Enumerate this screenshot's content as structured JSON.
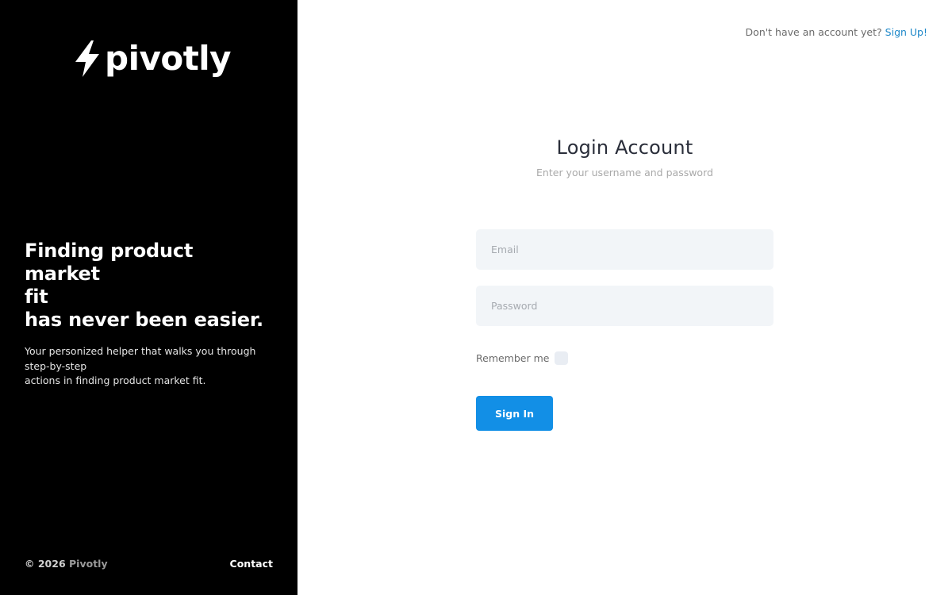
{
  "brand": {
    "name": "pivotly",
    "icon": "lightning-bolt-icon"
  },
  "hero": {
    "title_lines": [
      "Finding product market",
      "fit",
      "has never been easier."
    ],
    "subtitle_lines": [
      "Your personized helper that walks you through",
      "step-by-step",
      "actions in finding product market fit."
    ]
  },
  "footer": {
    "copyright": "© 2026",
    "brand": "Pivotly",
    "contact": "Contact"
  },
  "signup": {
    "prompt": "Don't have an account yet?",
    "link": "Sign Up!"
  },
  "login": {
    "title": "Login Account",
    "subtitle": "Enter your username and password",
    "email_placeholder": "Email",
    "password_placeholder": "Password",
    "remember_label": "Remember me",
    "submit_label": "Sign In"
  },
  "colors": {
    "sidebar_bg": "#000000",
    "accent": "#128fe6",
    "link": "#1e88c9",
    "field_bg": "#f2f5f8"
  }
}
